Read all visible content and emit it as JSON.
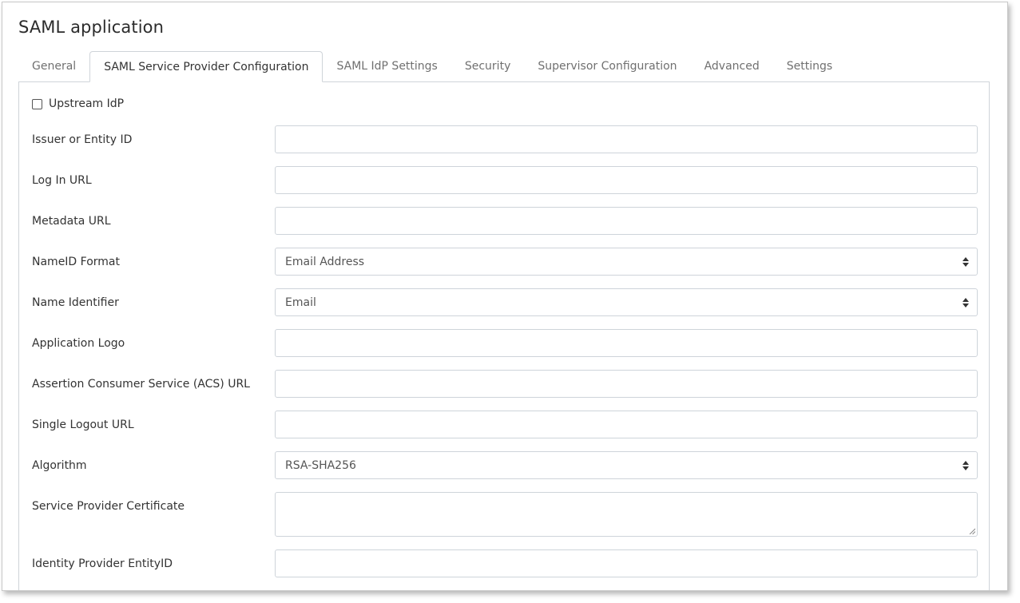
{
  "window": {
    "title": "SAML application"
  },
  "tabs": [
    {
      "label": "General",
      "active": false
    },
    {
      "label": "SAML Service Provider Configuration",
      "active": true
    },
    {
      "label": "SAML IdP Settings",
      "active": false
    },
    {
      "label": "Security",
      "active": false
    },
    {
      "label": "Supervisor Configuration",
      "active": false
    },
    {
      "label": "Advanced",
      "active": false
    },
    {
      "label": "Settings",
      "active": false
    }
  ],
  "form": {
    "upstream_idp": {
      "label": "Upstream IdP",
      "checked": false
    },
    "fields": {
      "issuer": {
        "label": "Issuer or Entity ID",
        "value": ""
      },
      "login_url": {
        "label": "Log In URL",
        "value": ""
      },
      "metadata_url": {
        "label": "Metadata URL",
        "value": ""
      },
      "nameid_format": {
        "label": "NameID Format",
        "value": "Email Address"
      },
      "name_identifier": {
        "label": "Name Identifier",
        "value": "Email"
      },
      "app_logo": {
        "label": "Application Logo",
        "value": ""
      },
      "acs_url": {
        "label": "Assertion Consumer Service (ACS) URL",
        "value": ""
      },
      "logout_url": {
        "label": "Single Logout URL",
        "value": ""
      },
      "algorithm": {
        "label": "Algorithm",
        "value": "RSA-SHA256"
      },
      "sp_certificate": {
        "label": "Service Provider Certificate",
        "value": ""
      },
      "idp_entityid": {
        "label": "Identity Provider EntityID",
        "value": ""
      }
    }
  },
  "icons": {
    "select_caret": "sort-caret-icon",
    "resize_handle": "resize-grip-icon"
  }
}
